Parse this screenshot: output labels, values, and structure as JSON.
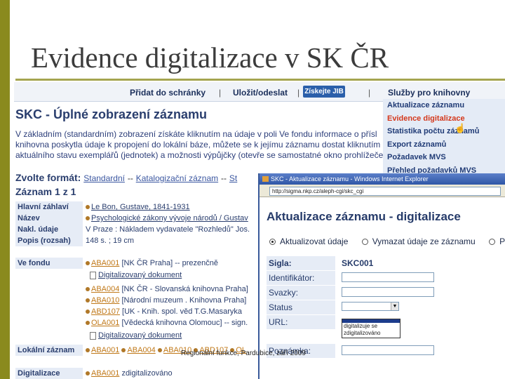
{
  "slide": {
    "title": "Evidence digitalizace v SK ČR",
    "footer": "Regionální funkce, Pardubice, září 2009"
  },
  "skc": {
    "toolbar": {
      "add_to_basket": "Přidat do schránky",
      "save_send": "Uložit/odeslat",
      "ziskej": "Získejte JIB",
      "services_head": "Služby pro knihovny",
      "separator": "|"
    },
    "services_menu": [
      "Aktualizace záznamu",
      "Evidence digitalizace",
      "Statistika počtu záznamů",
      "Export záznamů",
      "Požadavek MVS",
      "Přehled požadavků MVS"
    ],
    "page_title": "SKC - Úplné zobrazení záznamu",
    "intro_lines": [
      "V základním (standardním) zobrazení získáte kliknutím na údaje v poli Ve fondu informace o přísl",
      "knihovna poskytla údaje k propojení do lokální báze, můžete se k jejímu záznamu dostat kliknutím na",
      "aktuálního stavu exemplářů (jednotek) a možnosti výpůjčky (otevře se samostatné okno prohlížeče)"
    ],
    "format_label": "Zvolte formát:",
    "format_links": [
      "Standardní",
      "Katalogizační záznam",
      "St"
    ],
    "format_dash": "--",
    "record_label": "Záznam 1 z 1",
    "fields": [
      {
        "label": "Hlavní záhlaví",
        "value": "Le Bon, Gustave, 1841-1931"
      },
      {
        "label": "Název",
        "value": "Psychologické zákony vývoje národů / Gustav"
      },
      {
        "label": "Nakl. údaje",
        "value": "V Praze : Nákladem vydavatele \"Rozhledů\" Jos."
      },
      {
        "label": "Popis (rozsah)",
        "value": "148 s. ; 19 cm"
      }
    ],
    "ve_fondu_label": "Ve fondu",
    "ve_fondu": [
      {
        "code": "ABA001",
        "text": "[NK ČR Praha] -- prezenčně"
      },
      {
        "doc": "Digitalizovaný dokument"
      },
      {
        "code": "ABA004",
        "text": "[NK ČR - Slovanská knihovna Praha]"
      },
      {
        "code": "ABA010",
        "text": "[Národní muzeum . Knihovna Praha]"
      },
      {
        "code": "ABD107",
        "text": "[UK - Knih. spol. věd T.G.Masaryka"
      },
      {
        "code": "OLA001",
        "text": "[Vědecká knihovna Olomouc] -- sign."
      },
      {
        "doc": "Digitalizovaný dokument"
      }
    ],
    "lokalni_label": "Lokální záznam",
    "lokalni": [
      "ABA001",
      "ABA004",
      "ABA010",
      "ABD107",
      "OL"
    ],
    "digitalizace_label": "Digitalizace",
    "digitalizace": {
      "code": "ABA001",
      "text": "zdigitalizováno"
    }
  },
  "popup": {
    "window_title": "SKC - Aktualizace záznamu - Windows Internet Explorer",
    "address": "http://sigma.nkp.cz/aleph-cgi/skc_cgi",
    "heading": "Aktualizace záznamu - digitalizace",
    "radio_options": [
      {
        "label": "Aktualizovat údaje",
        "checked": true
      },
      {
        "label": "Vymazat údaje ze záznamu",
        "checked": false
      },
      {
        "label": "Po",
        "checked": false
      }
    ],
    "form": {
      "sigla_label": "Sigla:",
      "sigla_value": "SKC001",
      "identifikator_label": "Identifikátor:",
      "svazky_label": "Svazky:",
      "status_label": "Status digitalizace:",
      "url_label": "URL:",
      "poznamka_label": "Poznámka:"
    },
    "dropdown_options": [
      "digitalizuje se",
      "zdigitalizováno"
    ]
  },
  "colors": {
    "olive_bar": "#8a8a1e",
    "skc_blue": "#2a3e6e",
    "active_menu": "#d4381c"
  }
}
